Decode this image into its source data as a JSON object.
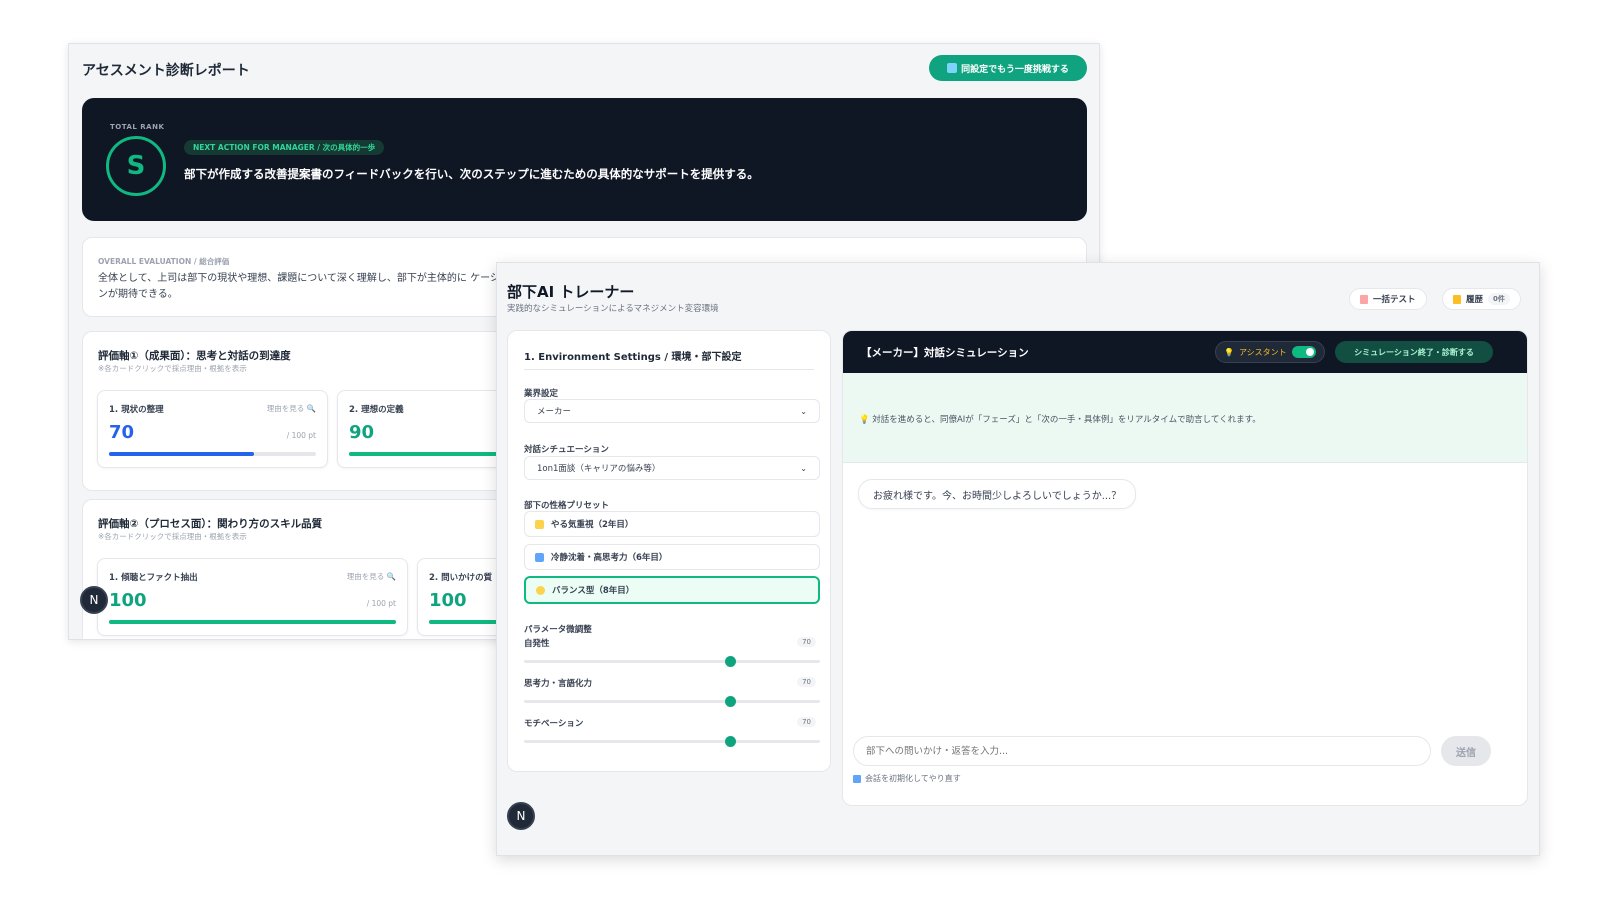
{
  "report": {
    "title": "アセスメント診断レポート",
    "retry_label": "同設定でもう一度挑戦する",
    "total_rank_label": "TOTAL RANK",
    "rank": "S",
    "next_action_label": "NEXT ACTION FOR MANAGER / 次の具体的一歩",
    "next_action_text": "部下が作成する改善提案書のフィードバックを行い、次のステップに進むための具体的なサポートを提供する。",
    "overall_label": "OVERALL EVALUATION / 総合評価",
    "overall_text": "全体として、上司は部下の現状や理想、課題について深く理解し、部下が主体的に ケーションが期待できる。",
    "axis1": {
      "title": "評価軸①（成果面）：思考と対話の到達度",
      "subtitle": "※各カードクリックで採点理由・根拠を表示",
      "cards": [
        {
          "name": "1. 現状の整理",
          "reason": "理由を見る 🔍",
          "score": 70,
          "unit": "/ 100 pt",
          "color": "#2563eb"
        },
        {
          "name": "2. 理想の定義",
          "reason": "",
          "score": 90,
          "unit": "",
          "color": "#10b981"
        }
      ]
    },
    "axis2": {
      "title": "評価軸②（プロセス面）：関わり方のスキル品質",
      "subtitle": "※各カードクリックで採点理由・根拠を表示",
      "cards": [
        {
          "name": "1. 傾聴とファクト抽出",
          "reason": "理由を見る 🔍",
          "score": 100,
          "unit": "/ 100 pt",
          "color": "#10b981"
        },
        {
          "name": "2. 問いかけの質",
          "reason": "",
          "score": 100,
          "unit": "",
          "color": "#10b981"
        }
      ]
    },
    "badge": "N"
  },
  "trainer": {
    "title": "部下AI トレーナー",
    "subtitle": "実践的なシミュレーションによるマネジメント変容環境",
    "bulk_test_label": "一括テスト",
    "history_label": "履歴",
    "history_count": "0件",
    "settings": {
      "title": "1. Environment Settings / 環境・部下設定",
      "industry_label": "業界設定",
      "industry_value": "メーカー",
      "situation_label": "対話シチュエーション",
      "situation_value": "1on1面談（キャリアの悩み等）",
      "preset_label": "部下の性格プリセット",
      "presets": [
        {
          "label": "やる気重視（2年目）",
          "active": false
        },
        {
          "label": "冷静沈着・高思考力（6年目）",
          "active": false
        },
        {
          "label": "バランス型（8年目）",
          "active": true
        }
      ],
      "param_label": "パラメータ微調整",
      "sliders": [
        {
          "label": "自発性",
          "value": 70
        },
        {
          "label": "思考力・言語化力",
          "value": 70
        },
        {
          "label": "モチベーション",
          "value": 70
        }
      ]
    },
    "chat": {
      "title": "【メーカー】対話シミュレーション",
      "assistant_label": "アシスタント",
      "end_label": "シミュレーション終了・診断する",
      "hint": "対話を進めると、同僚AIが「フェーズ」と「次の一手・具体例」をリアルタイムで助言してくれます。",
      "first_message": "お疲れ様です。今、お時間少しよろしいでしょうか...？",
      "input_placeholder": "部下への問いかけ・返答を入力...",
      "send_label": "送信",
      "reset_label": "会話を初期化してやり直す"
    },
    "badge": "N"
  },
  "icons": {
    "retry": "refresh-icon",
    "bulk_test": "clipboard-icon",
    "history": "scroll-icon",
    "assistant": "lightbulb-icon",
    "hint": "lightbulb-icon",
    "reset": "reset-icon",
    "search": "magnifier-icon"
  },
  "colors": {
    "accent": "#10a37f",
    "dark": "#0f1624",
    "blue": "#2563eb",
    "green": "#10b981"
  }
}
